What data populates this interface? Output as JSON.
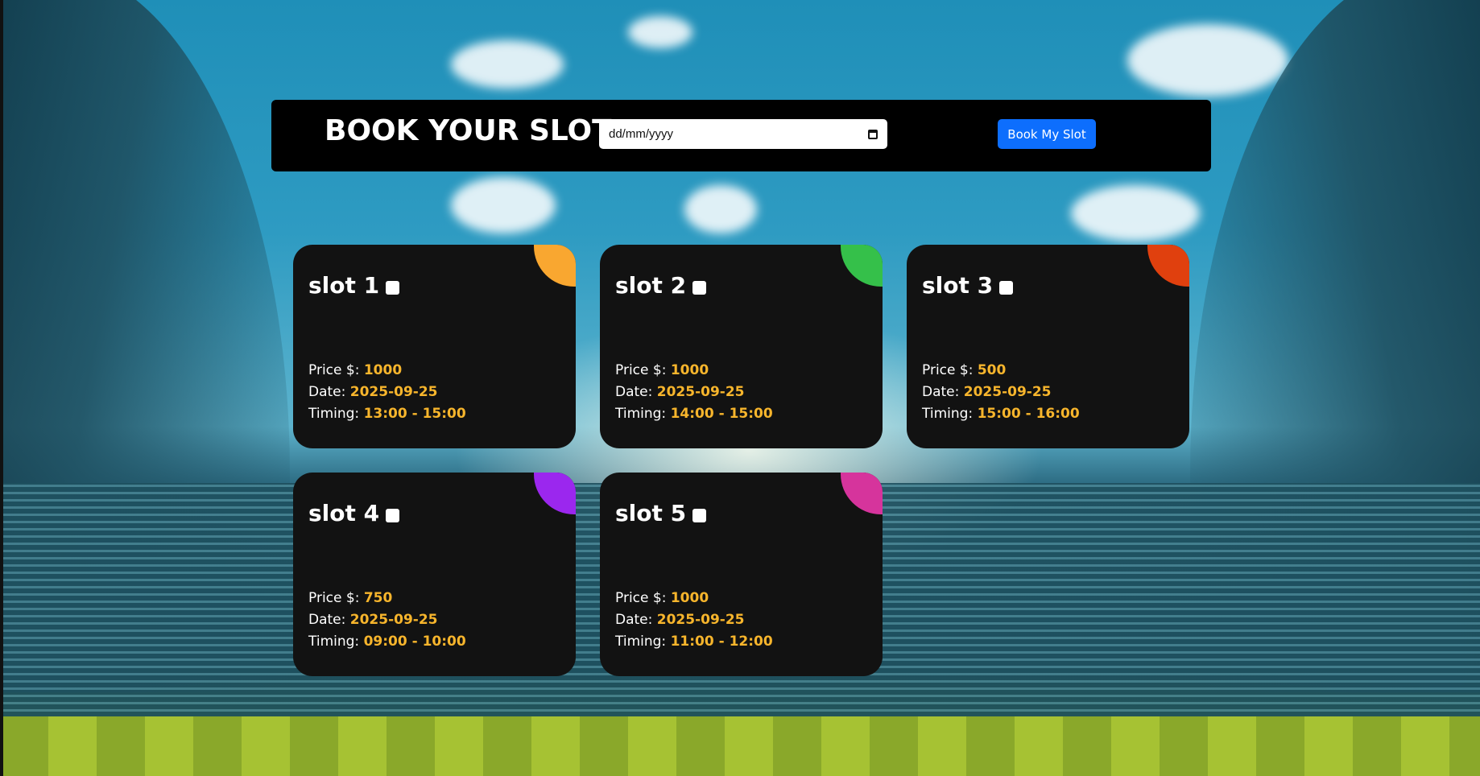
{
  "header": {
    "title": "BOOK YOUR SLOT",
    "date_placeholder": "dd/mm/yyyy",
    "book_button_label": "Book My Slot"
  },
  "labels": {
    "price": "Price $:",
    "date": "Date:",
    "timing": "Timing:"
  },
  "slots": [
    {
      "name": "slot 1",
      "price": "1000",
      "date": "2025-09-25",
      "timing": "13:00 - 15:00",
      "accent": "#f9a730",
      "checked": false
    },
    {
      "name": "slot 2",
      "price": "1000",
      "date": "2025-09-25",
      "timing": "14:00 - 15:00",
      "accent": "#35c04a",
      "checked": false
    },
    {
      "name": "slot 3",
      "price": "500",
      "date": "2025-09-25",
      "timing": "15:00 - 16:00",
      "accent": "#e0400e",
      "checked": false
    },
    {
      "name": "slot 4",
      "price": "750",
      "date": "2025-09-25",
      "timing": "09:00 - 10:00",
      "accent": "#9b27ee",
      "checked": false
    },
    {
      "name": "slot 5",
      "price": "1000",
      "date": "2025-09-25",
      "timing": "11:00 - 12:00",
      "accent": "#d6349c",
      "checked": false
    }
  ]
}
